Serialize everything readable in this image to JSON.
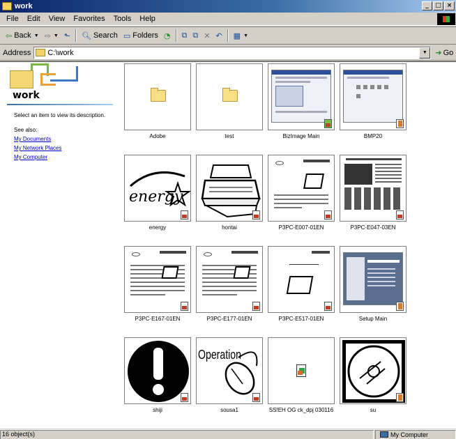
{
  "window": {
    "title": "work",
    "minimize": "_",
    "maximize": "□",
    "close": "×"
  },
  "menu": [
    "File",
    "Edit",
    "View",
    "Favorites",
    "Tools",
    "Help"
  ],
  "toolbar": {
    "back": "Back",
    "search": "Search",
    "folders": "Folders"
  },
  "address": {
    "label": "Address",
    "path": "C:\\work",
    "go": "Go"
  },
  "left_pane": {
    "folder_name": "work",
    "description": "Select an item to view its description.",
    "see_also": "See also:",
    "links": [
      "My Documents",
      "My Network Places",
      "My Computer"
    ]
  },
  "items": [
    {
      "label": "Adobe",
      "kind": "folder"
    },
    {
      "label": "test",
      "kind": "folder"
    },
    {
      "label": "BizImage Main",
      "kind": "screenshot"
    },
    {
      "label": "BMP20",
      "kind": "screenshot"
    },
    {
      "label": "energy",
      "kind": "energy"
    },
    {
      "label": "hontai",
      "kind": "hontai"
    },
    {
      "label": "P3PC-E007-01EN",
      "kind": "document"
    },
    {
      "label": "P3PC-E047-03EN",
      "kind": "document-dense"
    },
    {
      "label": "P3PC-E167-01EN",
      "kind": "document"
    },
    {
      "label": "P3PC-E177-01EN",
      "kind": "document"
    },
    {
      "label": "P3PC-E517-01EN",
      "kind": "document-device"
    },
    {
      "label": "Setup Main",
      "kind": "screenshot"
    },
    {
      "label": "shiji",
      "kind": "warning"
    },
    {
      "label": "sousa1",
      "kind": "operation"
    },
    {
      "label": "SS!EH OG ck_dpj 030116",
      "kind": "file"
    },
    {
      "label": "su",
      "kind": "cd"
    }
  ],
  "artwork": {
    "energy": "energy",
    "operation": "Operation"
  },
  "status": {
    "count": "16 object(s)",
    "zone": "My Computer"
  }
}
